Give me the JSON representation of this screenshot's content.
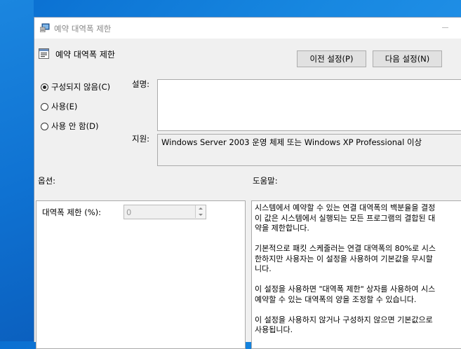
{
  "window": {
    "title": "예약 대역폭 제한"
  },
  "header": {
    "title": "예약 대역폭 제한"
  },
  "buttons": {
    "prev": "이전 설정(P)",
    "next": "다음 설정(N)"
  },
  "radios": [
    {
      "label": "구성되지 않음(C)",
      "checked": true
    },
    {
      "label": "사용(E)",
      "checked": false
    },
    {
      "label": "사용 안 함(D)",
      "checked": false
    }
  ],
  "labels": {
    "description": "설명:",
    "supported": "지원:",
    "options": "옵션:",
    "help": "도움말:"
  },
  "supported_text": "Windows Server 2003 운영 체제 또는 Windows XP Professional 이상",
  "options": {
    "bandwidth_label": "대역폭 제한 (%):",
    "bandwidth_value": "0"
  },
  "help_lines": [
    "시스템에서 예약할 수 있는 연결 대역폭의 백분율을 결정",
    "이 값은 시스템에서 실행되는 모든 프로그램의 결합된 대",
    "약을 제한합니다.",
    "기본적으로 패킷 스케줄러는 연결 대역폭의 80%로 시스",
    "한하지만 사용자는 이 설정을 사용하여 기본값을 무시할",
    "니다.",
    "이 설정을 사용하면 \"대역폭 제한\" 상자를 사용하여 시스",
    "예약할 수 있는 대역폭의 양을 조정할 수 있습니다.",
    "이 설정을 사용하지 않거나 구성하지 않으면 기본값으로",
    "사용됩니다."
  ]
}
